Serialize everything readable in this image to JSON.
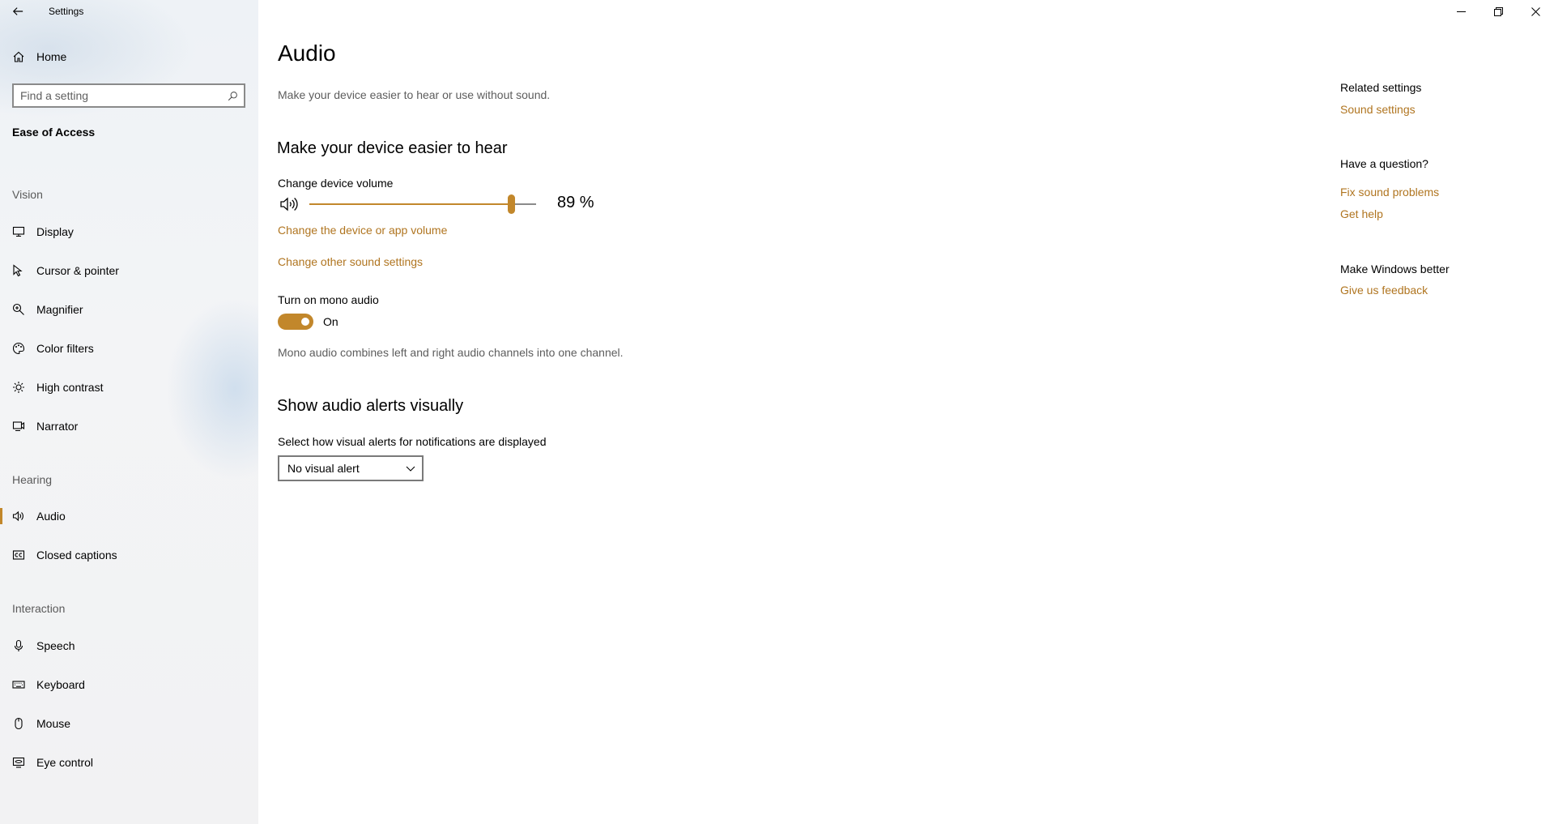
{
  "window": {
    "app_title": "Settings"
  },
  "sidebar": {
    "home_label": "Home",
    "search": {
      "placeholder": "Find a setting",
      "value": ""
    },
    "section_header": "Ease of Access",
    "groups": {
      "vision": "Vision",
      "hearing": "Hearing",
      "interaction": "Interaction"
    },
    "items": {
      "display": "Display",
      "cursor": "Cursor & pointer",
      "magnifier": "Magnifier",
      "color_filters": "Color filters",
      "high_contrast": "High contrast",
      "narrator": "Narrator",
      "audio": "Audio",
      "closed_captions": "Closed captions",
      "speech": "Speech",
      "keyboard": "Keyboard",
      "mouse": "Mouse",
      "eye_control": "Eye control"
    },
    "selected_item": "audio"
  },
  "main": {
    "title": "Audio",
    "description": "Make your device easier to hear or use without sound.",
    "hear_heading": "Make your device easier to hear",
    "volume_label": "Change device volume",
    "volume_value": 89,
    "volume_text": "89 %",
    "link_device_app_volume": "Change the device or app volume",
    "link_other_sound": "Change other sound settings",
    "mono_label": "Turn on mono audio",
    "mono_state": "On",
    "mono_description": "Mono audio combines left and right audio channels into one channel.",
    "alerts_heading": "Show audio alerts visually",
    "alerts_label": "Select how visual alerts for notifications are displayed",
    "alerts_selected": "No visual alert"
  },
  "right": {
    "related_heading": "Related settings",
    "sound_settings": "Sound settings",
    "question_heading": "Have a question?",
    "fix_sound": "Fix sound problems",
    "get_help": "Get help",
    "better_heading": "Make Windows better",
    "feedback": "Give us feedback"
  },
  "colors": {
    "accent": "#c2872b",
    "link": "#b07520"
  }
}
